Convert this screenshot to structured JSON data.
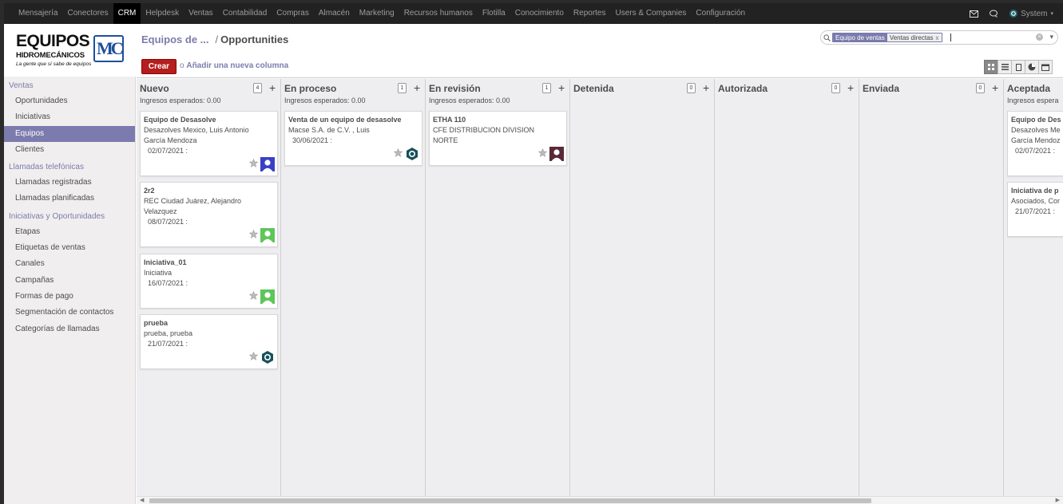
{
  "topnav": {
    "items": [
      "Mensajería",
      "Conectores",
      "CRM",
      "Helpdesk",
      "Ventas",
      "Contabilidad",
      "Compras",
      "Almacén",
      "Marketing",
      "Recursos humanos",
      "Flotilla",
      "Conocimiento",
      "Reportes",
      "Users & Companies",
      "Configuración"
    ],
    "active_index": 2,
    "user": "System"
  },
  "logo": {
    "line1": "EQUIPOS",
    "line2": "HIDROMECÁNICOS",
    "tagline": "La gente que sí sabe de equipos",
    "mark": "MC"
  },
  "sidebar": {
    "sections": [
      {
        "title": "Ventas",
        "items": [
          "Oportunidades",
          "Iniciativas",
          "Equipos",
          "Clientes"
        ]
      },
      {
        "title": "Llamadas telefónicas",
        "items": [
          "Llamadas registradas",
          "Llamadas planificadas"
        ]
      },
      {
        "title": "Iniciativas y Oportunidades",
        "items": [
          "Etapas",
          "Etiquetas de ventas",
          "Canales",
          "Campañas",
          "Formas de pago",
          "Segmentación de contactos",
          "Categorías de llamadas"
        ]
      }
    ],
    "active_item": "Equipos"
  },
  "breadcrumb": {
    "parent": "Equipos de ...",
    "current": "Opportunities"
  },
  "search": {
    "facet_label": "Equipo de ventas",
    "facet_value": "Ventas directas",
    "remove": "x"
  },
  "actions": {
    "create": "Crear",
    "add_column": "Añadir una nueva columna"
  },
  "kanban": {
    "columns": [
      {
        "title": "Nuevo",
        "count": "4",
        "subtitle": "Ingresos esperados: 0.00",
        "cards": [
          {
            "title": "Equipo de Desasolve",
            "lines": [
              "Desazolves Mexico, Luis Antonio",
              "García Mendoza"
            ],
            "date": "02/07/2021 :",
            "avatar": "person-blue"
          },
          {
            "title": "2r2",
            "lines": [
              "REC Ciudad Juárez, Alejandro",
              "Velazquez"
            ],
            "date": "08/07/2021 :",
            "avatar": "person-green"
          },
          {
            "title": "Iniciativa_01",
            "lines": [
              "Iniciativa"
            ],
            "date": "16/07/2021 :",
            "avatar": "person-green"
          },
          {
            "title": "prueba",
            "lines": [
              "prueba, prueba"
            ],
            "date": "21/07/2021 :",
            "avatar": "odoo-teal"
          }
        ]
      },
      {
        "title": "En proceso",
        "count": "1",
        "subtitle": "Ingresos esperados: 0.00",
        "cards": [
          {
            "title": "Venta de un equipo de desasolve",
            "lines": [
              "Macse S.A. de C.V. , Luis"
            ],
            "date": "30/06/2021 :",
            "avatar": "odoo-teal"
          }
        ]
      },
      {
        "title": "En revisión",
        "count": "1",
        "subtitle": "Ingresos esperados: 0.00",
        "cards": [
          {
            "title": "ETHA 110",
            "lines": [
              "CFE DISTRIBUCION DIVISION",
              "NORTE"
            ],
            "date": "",
            "avatar": "person-dark"
          }
        ]
      },
      {
        "title": "Detenida",
        "count": "0",
        "subtitle": "",
        "cards": []
      },
      {
        "title": "Autorizada",
        "count": "0",
        "subtitle": "",
        "cards": []
      },
      {
        "title": "Enviada",
        "count": "0",
        "subtitle": "",
        "cards": []
      },
      {
        "title": "Aceptada",
        "count": "",
        "subtitle": "Ingresos espera",
        "cards": [
          {
            "title": "Equipo de Des",
            "lines": [
              "Desazolves Me",
              "García Mendoz"
            ],
            "date": "02/07/2021 :",
            "avatar": ""
          },
          {
            "title": "Iniciativa de p",
            "lines": [
              "Asociados, Cor"
            ],
            "date": "21/07/2021 :",
            "avatar": ""
          }
        ]
      }
    ]
  },
  "colors": {
    "accent": "#7c7bad",
    "create": "#b51e1e",
    "topbar": "#222222"
  }
}
